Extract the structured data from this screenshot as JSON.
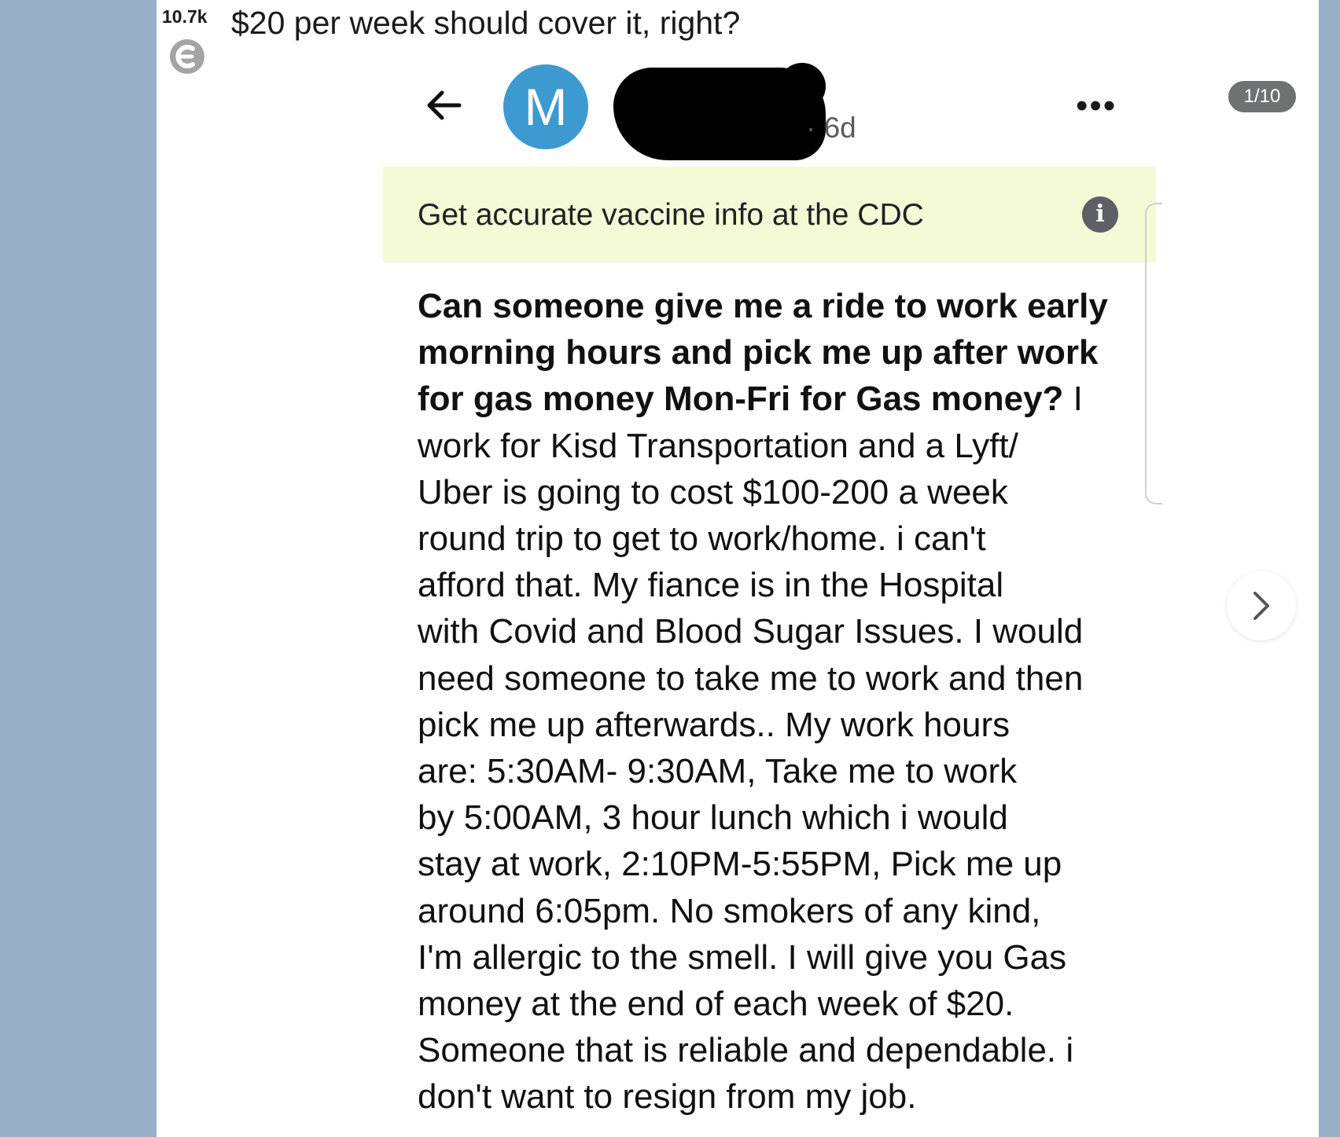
{
  "reddit_post": {
    "score": "10.7k",
    "title": "$20 per week should cover it, right?",
    "gallery_counter": "1/10"
  },
  "embedded_post": {
    "avatar_letter": "M",
    "time_meta": "· 6d",
    "banner_text": "Get accurate vaccine info at the CDC",
    "info_icon_glyph": "i",
    "body_lines": [
      {
        "text": "Can someone give me a ride to work early",
        "bold": true
      },
      {
        "text": "morning hours and pick me up after work",
        "bold": true
      },
      {
        "text_bold": "for gas money Mon-Fri for Gas money?",
        "text_rest": " I"
      },
      {
        "text": "work for Kisd Transportation and a Lyft/"
      },
      {
        "text": "Uber is going to cost $100-200 a week"
      },
      {
        "text": "round trip to get to work/home. i can't"
      },
      {
        "text": "afford that. My fiance is in the Hospital"
      },
      {
        "text": "with Covid and Blood Sugar Issues. I would"
      },
      {
        "text": "need someone to take me to work and then"
      },
      {
        "text": "pick me up afterwards.. My work hours"
      },
      {
        "text": "are: 5:30AM- 9:30AM, Take me to work"
      },
      {
        "text": "by 5:00AM, 3 hour lunch which i would"
      },
      {
        "text": "stay at work, 2:10PM-5:55PM, Pick me up"
      },
      {
        "text": "around 6:05pm. No smokers of any kind,"
      },
      {
        "text": "I'm allergic to the smell. I will give you Gas"
      },
      {
        "text": "money at the end of each week of $20."
      },
      {
        "text": "Someone that is reliable and dependable. i"
      },
      {
        "text": "don't want to resign from my job."
      }
    ]
  },
  "colors": {
    "page_bg": "#98b0c6",
    "avatar": "#3d9ad1",
    "banner_bg": "#f4f9d6",
    "counter_bg": "#6f7173"
  },
  "icons": [
    "community-icon",
    "back-arrow-icon",
    "more-icon",
    "info-icon",
    "chevron-right-icon"
  ]
}
